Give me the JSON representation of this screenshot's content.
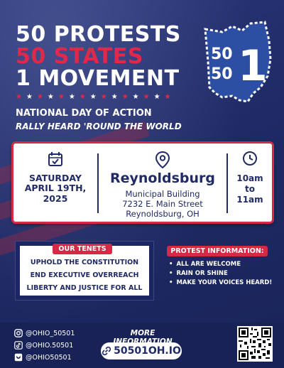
{
  "headline": {
    "line1": "50 PROTESTS",
    "line2": "50 STATES",
    "line3": "1 MOVEMENT"
  },
  "logo": {
    "top": "50",
    "bottom": "50",
    "big": "1",
    "shape": "ohio-state-icon"
  },
  "subheadline": {
    "line1": "NATIONAL DAY OF ACTION",
    "line2": "RALLY HEARD 'ROUND THE WORLD"
  },
  "event": {
    "date_line1": "SATURDAY",
    "date_line2": "APRIL 19TH,",
    "date_line3": "2025",
    "city": "Reynoldsburg",
    "venue": "Municipal Building",
    "street": "7232 E. Main Street",
    "city_state": "Reynoldsburg, OH",
    "time_start": "10am",
    "time_to": "to",
    "time_end": "11am"
  },
  "tenets": {
    "title": "OUR TENETS",
    "items": [
      "UPHOLD THE CONSTITUTION",
      "END EXECUTIVE OVERREACH",
      "LIBERTY AND JUSTICE FOR ALL"
    ]
  },
  "protest_info": {
    "title": "PROTEST INFORMATION:",
    "items": [
      "ALL ARE WELCOME",
      "RAIN OR SHINE",
      "MAKE YOUR VOICES HEARD!"
    ]
  },
  "footer": {
    "socials": [
      {
        "icon": "instagram-icon",
        "handle": "@OHIO_50501"
      },
      {
        "icon": "tiktok-icon",
        "handle": "@OHIO.50501"
      },
      {
        "icon": "bluesky-icon",
        "handle": "@OHIO50501"
      }
    ],
    "more_info": "MORE INFORMATION",
    "url": "50501OH.IO",
    "link_icon": "link-icon",
    "qr_icon": "qr-code-icon"
  },
  "colors": {
    "navy": "#1f2a66",
    "red": "#d42a45",
    "white": "#ffffff"
  }
}
